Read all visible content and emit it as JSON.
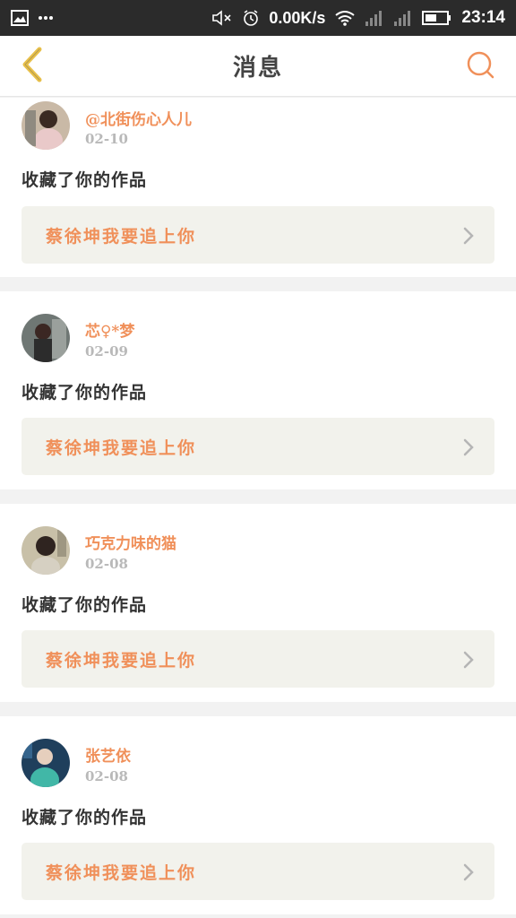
{
  "status_bar": {
    "speed": "0.00K/s",
    "time": "23:14",
    "icons": [
      "image-icon",
      "more-dots-icon",
      "mute-icon",
      "alarm-icon",
      "wifi-icon",
      "signal-1-icon",
      "signal-2-icon",
      "battery-icon"
    ]
  },
  "nav": {
    "title": "消息",
    "back_icon": "chevron-left-icon",
    "search_icon": "search-icon"
  },
  "colors": {
    "accent": "#f0905a",
    "back_arrow": "#e8c04a",
    "card_work_bg": "#f2f2ec"
  },
  "messages": [
    {
      "user": "@北街伤心人儿",
      "date": "02-10",
      "action": "收藏了你的作品",
      "work_title": "蔡徐坤我要追上你"
    },
    {
      "user": "芯♀*梦",
      "date": "02-09",
      "action": "收藏了你的作品",
      "work_title": "蔡徐坤我要追上你"
    },
    {
      "user": "巧克力味的猫",
      "date": "02-08",
      "action": "收藏了你的作品",
      "work_title": "蔡徐坤我要追上你"
    },
    {
      "user": "张艺依",
      "date": "02-08",
      "action": "收藏了你的作品",
      "work_title": "蔡徐坤我要追上你"
    }
  ]
}
